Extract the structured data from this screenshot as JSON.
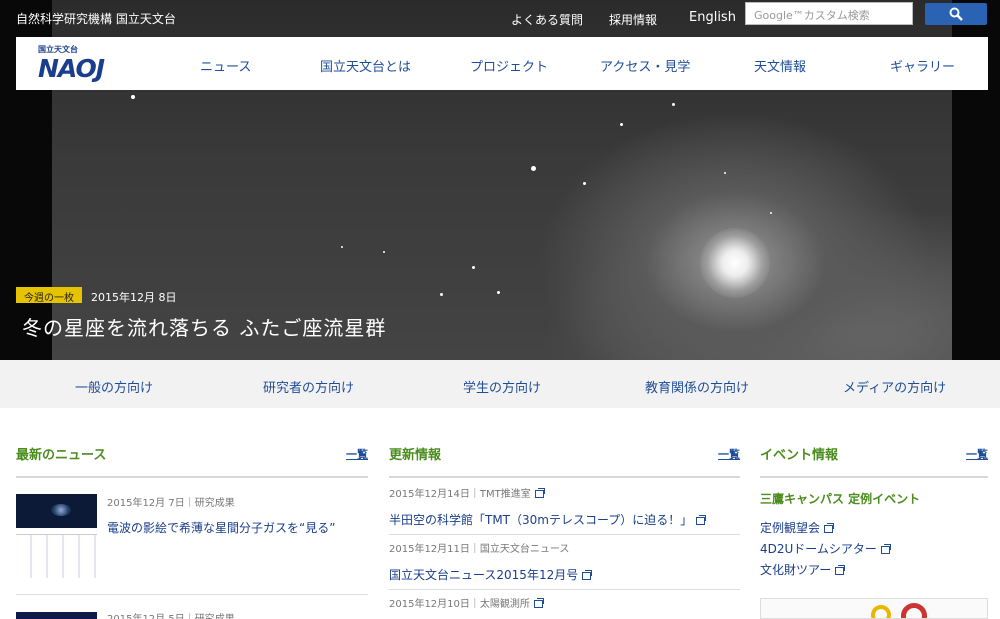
{
  "header": {
    "site_name": "自然科学研究機構 国立天文台",
    "util_links": [
      "よくある質問",
      "採用情報",
      "English"
    ],
    "search_placeholder": "Google™カスタム検索",
    "search_icon": "search-icon"
  },
  "logo": {
    "small": "国立天文台",
    "text": "NAOJ"
  },
  "nav": [
    "ニュース",
    "国立天文台とは",
    "プロジェクト",
    "アクセス・見学",
    "天文情報",
    "ギャラリー"
  ],
  "feature": {
    "badge": "今週の一枚",
    "date": "2015年12月 8日",
    "title": "冬の星座を流れ落ちる ふたご座流星群"
  },
  "audience": [
    "一般の方向け",
    "研究者の方向け",
    "学生の方向け",
    "教育関係の方向け",
    "メディアの方向け"
  ],
  "news": {
    "heading": "最新のニュース",
    "more": "一覧",
    "items": [
      {
        "date": "2015年12月 7日｜研究成果",
        "title": "電波の影絵で希薄な星間分子ガスを“見る”"
      },
      {
        "date": "2015年12月 5日｜研究成果",
        "title": ""
      }
    ]
  },
  "updates": {
    "heading": "更新情報",
    "more": "一覧",
    "items": [
      {
        "date": "2015年12月14日｜TMT推進室",
        "title": "半田空の科学館「TMT（30mテレスコープ）に迫る！」"
      },
      {
        "date": "2015年12月11日｜国立天文台ニュース",
        "title": "国立天文台ニュース2015年12月号"
      },
      {
        "date": "2015年12月10日｜太陽観測所",
        "title": ""
      }
    ]
  },
  "events": {
    "heading": "イベント情報",
    "more": "一覧",
    "subheading": "三鷹キャンパス 定例イベント",
    "links": [
      "定例観望会",
      "4D2Uドームシアター",
      "文化財ツアー"
    ]
  },
  "colors": {
    "accent_blue": "#1f4e99",
    "heading_green": "#4a8d1d",
    "badge_yellow": "#e6c300",
    "search_blue": "#2a62b4"
  }
}
